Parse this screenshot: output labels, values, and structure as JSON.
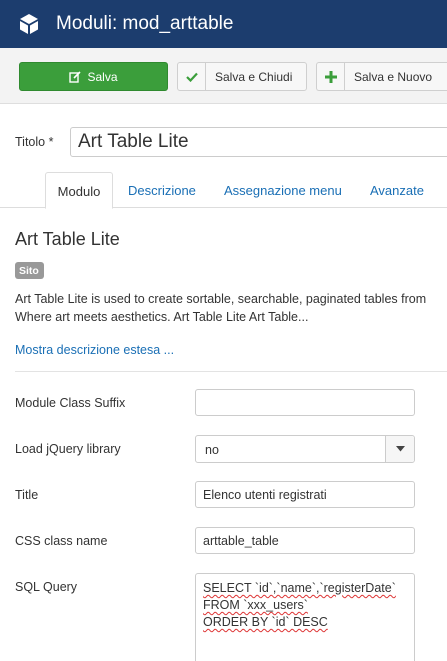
{
  "header": {
    "title": "Moduli: mod_arttable"
  },
  "toolbar": {
    "save_label": "Salva",
    "save_close_label": "Salva e Chiudi",
    "save_new_label": "Salva e Nuovo"
  },
  "form": {
    "title_label": "Titolo *",
    "title_value": "Art Table Lite"
  },
  "tabs": [
    {
      "label": "Modulo",
      "active": true
    },
    {
      "label": "Descrizione"
    },
    {
      "label": "Assegnazione menu"
    },
    {
      "label": "Avanzate"
    }
  ],
  "module": {
    "heading": "Art Table Lite",
    "badge": "Sito",
    "description_line1": "Art Table Lite is used to create sortable, searchable, paginated tables from",
    "description_line2": "Where art meets aesthetics. Art Table Lite Art Table...",
    "more_link": "Mostra descrizione estesa ..."
  },
  "fields": {
    "class_suffix": {
      "label": "Module Class Suffix",
      "value": ""
    },
    "jquery": {
      "label": "Load jQuery library",
      "value": "no"
    },
    "title": {
      "label": "Title",
      "value": "Elenco utenti registrati"
    },
    "css_class": {
      "label": "CSS class name",
      "value": "arttable_table"
    },
    "sql": {
      "label": "SQL Query",
      "line1": "SELECT `id`,`name`,`registerDate`",
      "line2": "FROM `xxx_users`",
      "line3": "ORDER BY `id` DESC"
    }
  },
  "colors": {
    "header_bg": "#1c3d6e",
    "save_bg": "#3b9e3b",
    "link": "#1a6fb5",
    "badge_bg": "#999999"
  }
}
